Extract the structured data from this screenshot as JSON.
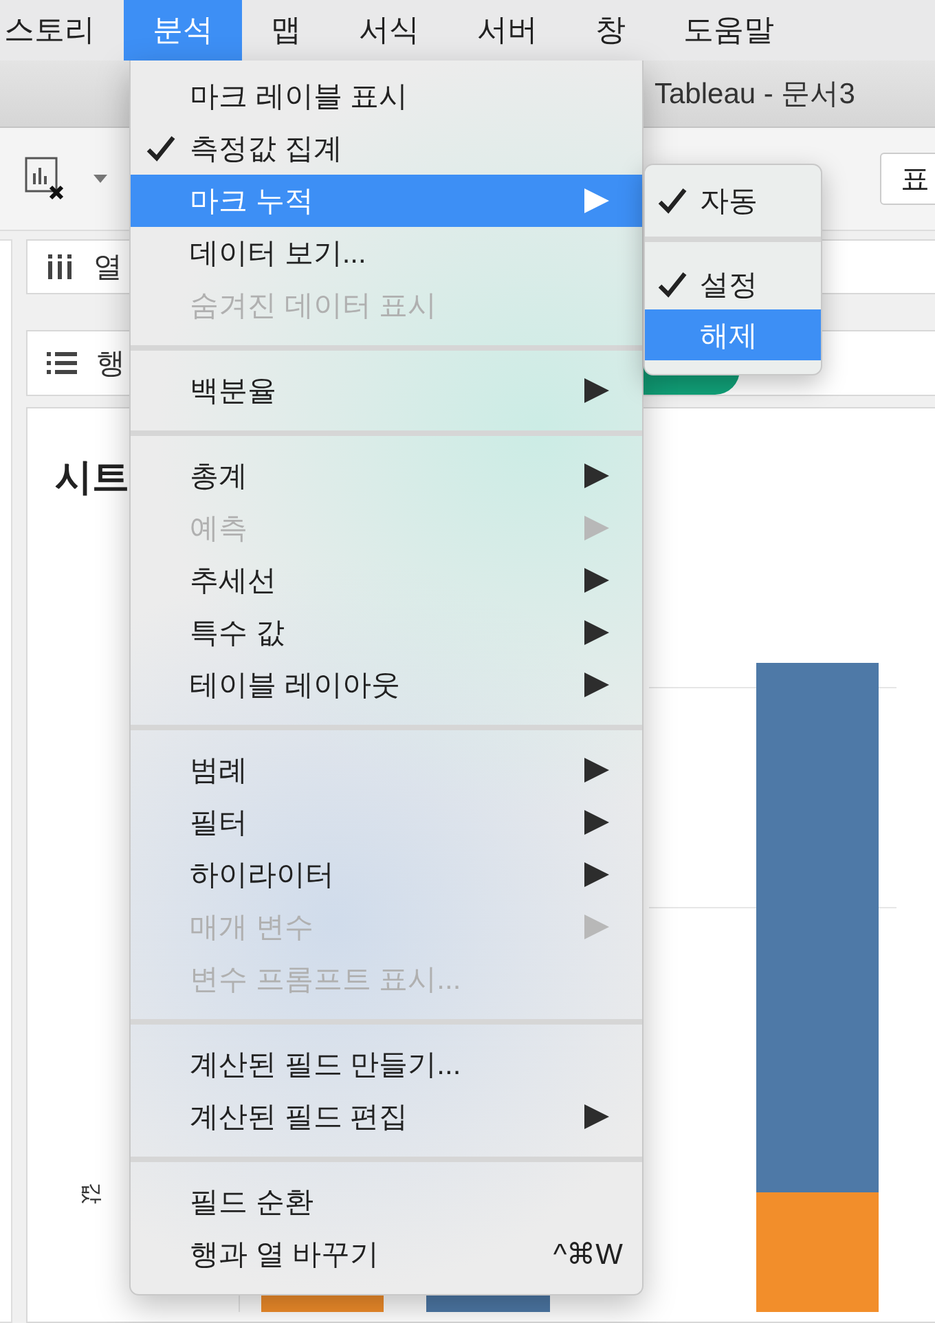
{
  "menu_bar": {
    "items": [
      {
        "label": "스토리",
        "selected": false
      },
      {
        "label": "분석",
        "selected": true
      },
      {
        "label": "맵",
        "selected": false
      },
      {
        "label": "서식",
        "selected": false
      },
      {
        "label": "서버",
        "selected": false
      },
      {
        "label": "창",
        "selected": false
      },
      {
        "label": "도움말",
        "selected": false
      }
    ]
  },
  "window": {
    "title": "Tableau - 문서3"
  },
  "toolbar": {
    "button_label": "표"
  },
  "shelves": [
    {
      "kind": "columns",
      "label": "열"
    },
    {
      "kind": "rows",
      "label": "행"
    }
  ],
  "sheet": {
    "title": "시트",
    "axis_label": "값"
  },
  "menu": {
    "items": [
      {
        "kind": "item",
        "label": "마크 레이블 표시",
        "checked": false,
        "disabled": false,
        "selected": false,
        "submenu": false
      },
      {
        "kind": "item",
        "label": "측정값 집계",
        "checked": true,
        "disabled": false,
        "selected": false,
        "submenu": false
      },
      {
        "kind": "item",
        "label": "마크 누적",
        "checked": false,
        "disabled": false,
        "selected": true,
        "submenu": true
      },
      {
        "kind": "item",
        "label": "데이터 보기...",
        "checked": false,
        "disabled": false,
        "selected": false,
        "submenu": false
      },
      {
        "kind": "item",
        "label": "숨겨진 데이터 표시",
        "checked": false,
        "disabled": true,
        "selected": false,
        "submenu": false
      },
      {
        "kind": "separator"
      },
      {
        "kind": "item",
        "label": "백분율",
        "checked": false,
        "disabled": false,
        "selected": false,
        "submenu": true
      },
      {
        "kind": "separator"
      },
      {
        "kind": "item",
        "label": "총계",
        "checked": false,
        "disabled": false,
        "selected": false,
        "submenu": true
      },
      {
        "kind": "item",
        "label": "예측",
        "checked": false,
        "disabled": true,
        "selected": false,
        "submenu": true
      },
      {
        "kind": "item",
        "label": "추세선",
        "checked": false,
        "disabled": false,
        "selected": false,
        "submenu": true
      },
      {
        "kind": "item",
        "label": "특수 값",
        "checked": false,
        "disabled": false,
        "selected": false,
        "submenu": true
      },
      {
        "kind": "item",
        "label": "테이블 레이아웃",
        "checked": false,
        "disabled": false,
        "selected": false,
        "submenu": true
      },
      {
        "kind": "separator"
      },
      {
        "kind": "item",
        "label": "범례",
        "checked": false,
        "disabled": false,
        "selected": false,
        "submenu": true
      },
      {
        "kind": "item",
        "label": "필터",
        "checked": false,
        "disabled": false,
        "selected": false,
        "submenu": true
      },
      {
        "kind": "item",
        "label": "하이라이터",
        "checked": false,
        "disabled": false,
        "selected": false,
        "submenu": true
      },
      {
        "kind": "item",
        "label": "매개 변수",
        "checked": false,
        "disabled": true,
        "selected": false,
        "submenu": true
      },
      {
        "kind": "item",
        "label": "변수 프롬프트 표시...",
        "checked": false,
        "disabled": true,
        "selected": false,
        "submenu": false
      },
      {
        "kind": "separator"
      },
      {
        "kind": "item",
        "label": "계산된 필드 만들기...",
        "checked": false,
        "disabled": false,
        "selected": false,
        "submenu": false
      },
      {
        "kind": "item",
        "label": "계산된 필드 편집",
        "checked": false,
        "disabled": false,
        "selected": false,
        "submenu": true
      },
      {
        "kind": "separator"
      },
      {
        "kind": "item",
        "label": "필드 순환",
        "checked": false,
        "disabled": false,
        "selected": false,
        "submenu": false
      },
      {
        "kind": "item",
        "label": "행과 열 바꾸기",
        "checked": false,
        "disabled": false,
        "selected": false,
        "submenu": false,
        "shortcut": "^⌘W"
      }
    ]
  },
  "submenu": {
    "items": [
      {
        "kind": "item",
        "label": "자동",
        "checked": true,
        "selected": false
      },
      {
        "kind": "separator"
      },
      {
        "kind": "item",
        "label": "설정",
        "checked": true,
        "selected": false
      },
      {
        "kind": "item",
        "label": "해제",
        "checked": false,
        "selected": true
      }
    ]
  }
}
